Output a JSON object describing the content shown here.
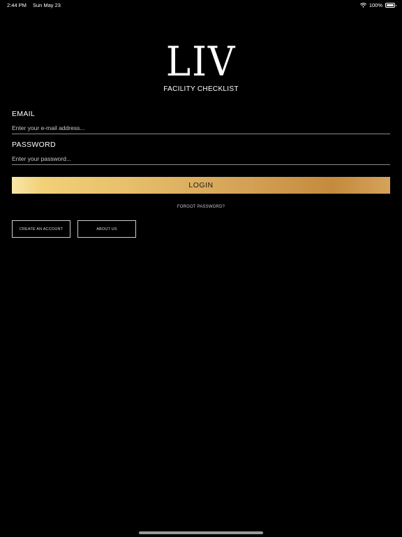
{
  "status_bar": {
    "time": "2:44 PM",
    "date": "Sun May 23",
    "battery": "100%",
    "icons": [
      "wifi-icon",
      "battery-icon"
    ]
  },
  "logo": {
    "mark": "LIV",
    "subtitle": "FACILITY CHECKLIST"
  },
  "form": {
    "email_label": "EMAIL",
    "email_placeholder": "Enter your e-mail address...",
    "password_label": "PASSWORD",
    "password_placeholder": "Enter your password...",
    "login_label": "LOGIN",
    "forgot_password": "FORGOT PASSWORD?"
  },
  "actions": {
    "create_account": "CREATE AN ACCOUNT",
    "about_us": "ABOUT US"
  },
  "colors": {
    "background": "#000000",
    "gold_start": "#f8e7a9",
    "gold_end": "#c58a3d"
  }
}
